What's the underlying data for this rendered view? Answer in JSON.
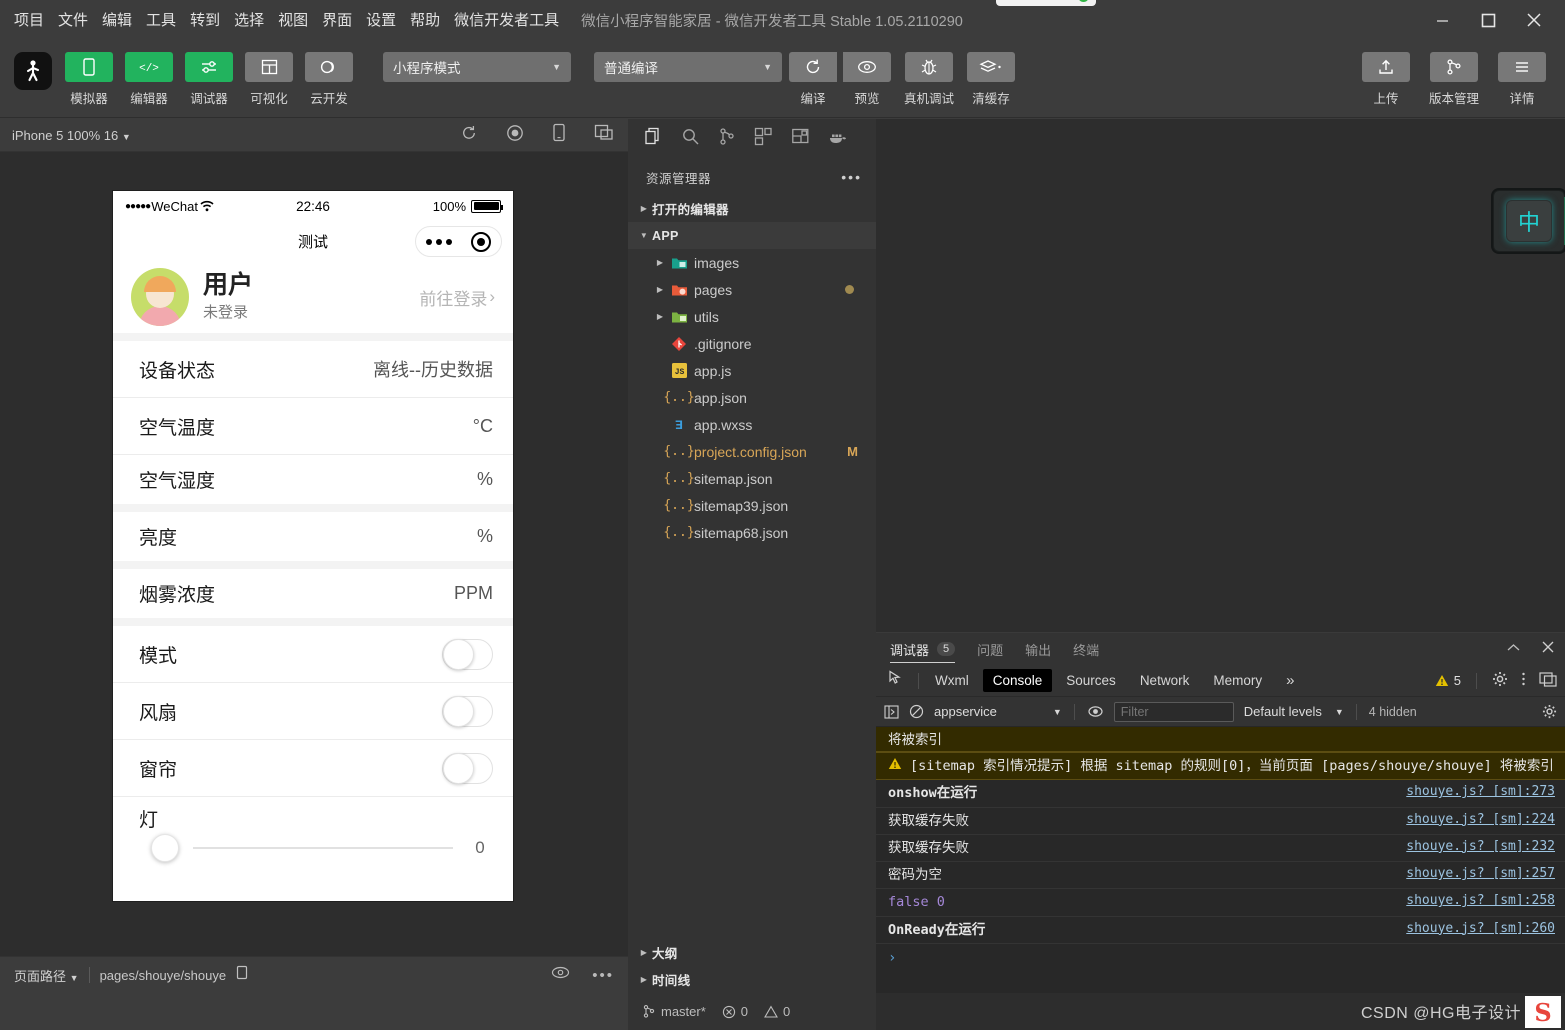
{
  "window": {
    "menu": [
      "项目",
      "文件",
      "编辑",
      "工具",
      "转到",
      "选择",
      "视图",
      "界面",
      "设置",
      "帮助",
      "微信开发者工具"
    ],
    "title": "微信小程序智能家居 - 微信开发者工具 Stable 1.05.2110290",
    "controls": {
      "minimize": "minimize-icon",
      "maximize": "maximize-icon",
      "close": "close-icon"
    }
  },
  "toolbar": {
    "avatar": "user-avatar-icon",
    "left_buttons": [
      {
        "label": "模拟器",
        "icon": "phone-icon",
        "active": true
      },
      {
        "label": "编辑器",
        "icon": "code-icon",
        "active": true
      },
      {
        "label": "调试器",
        "icon": "sliders-icon",
        "active": true
      },
      {
        "label": "可视化",
        "icon": "layout-icon",
        "active": false
      },
      {
        "label": "云开发",
        "icon": "cloud-icon",
        "active": false
      }
    ],
    "mode_select": "小程序模式",
    "compile_select": "普通编译",
    "center_buttons": [
      {
        "label": "编译",
        "icon": "refresh-icon"
      },
      {
        "label": "预览",
        "icon": "eye-icon"
      },
      {
        "label": "真机调试",
        "icon": "bug-icon"
      },
      {
        "label": "清缓存",
        "icon": "layers-icon"
      }
    ],
    "right_buttons": [
      {
        "label": "上传",
        "icon": "upload-icon"
      },
      {
        "label": "版本管理",
        "icon": "branch-icon"
      },
      {
        "label": "详情",
        "icon": "menu-icon"
      }
    ]
  },
  "simulator": {
    "device_label": "iPhone 5 100% 16",
    "bar_icons": [
      "refresh-icon",
      "record-icon",
      "rotate-device-icon",
      "multi-window-icon"
    ],
    "phone": {
      "status": {
        "carrier": "WeChat",
        "dots": "●●●●●",
        "wifi": "wifi-icon",
        "time": "22:46",
        "battery_pct": "100%"
      },
      "nav_title": "测试",
      "capsule": {
        "more": "more-dots-icon",
        "target": "target-icon"
      },
      "user": {
        "name": "用户",
        "sub": "未登录",
        "login_text": "前往登录",
        "chevron": "chevron-right-icon"
      },
      "rows": [
        {
          "label": "设备状态",
          "value": "离线--历史数据",
          "type": "value",
          "sep": false
        },
        {
          "label": "空气温度",
          "value": "°C",
          "type": "value",
          "sep": false
        },
        {
          "label": "空气湿度",
          "value": "%",
          "type": "value",
          "sep": true
        },
        {
          "label": "亮度",
          "value": "%",
          "type": "value",
          "sep": true
        },
        {
          "label": "烟雾浓度",
          "value": "PPM",
          "type": "value",
          "sep": true
        },
        {
          "label": "模式",
          "value": "",
          "type": "switch",
          "sep": false
        },
        {
          "label": "风扇",
          "value": "",
          "type": "switch",
          "sep": false
        },
        {
          "label": "窗帘",
          "value": "",
          "type": "switch",
          "sep": false
        }
      ],
      "slider": {
        "label": "灯",
        "value": "0"
      }
    },
    "footer": {
      "path_label": "页面路径",
      "path": "pages/shouye/shouye",
      "copy": "copy-icon",
      "eye": "eye-icon",
      "more": "more-icon"
    }
  },
  "explorer": {
    "activity_icons": [
      "files-icon",
      "search-icon",
      "source-control-icon",
      "extensions-icon",
      "debug-icon",
      "docker-icon"
    ],
    "title": "资源管理器",
    "more": "more-icon",
    "sections": [
      {
        "label": "打开的编辑器",
        "expanded": false
      },
      {
        "label": "APP",
        "expanded": true
      }
    ],
    "tree": [
      {
        "name": "images",
        "type": "folder",
        "icon_color": "#18a08c",
        "expanded": false,
        "indent": 2
      },
      {
        "name": "pages",
        "type": "folder",
        "icon_color": "#e85b3a",
        "expanded": false,
        "indent": 2,
        "dirty": true
      },
      {
        "name": "utils",
        "type": "folder",
        "icon_color": "#7cb342",
        "expanded": false,
        "indent": 2
      },
      {
        "name": ".gitignore",
        "type": "git",
        "icon_color": "#e8453c",
        "indent": 3
      },
      {
        "name": "app.js",
        "type": "js",
        "icon_color": "#e8c13b",
        "indent": 3
      },
      {
        "name": "app.json",
        "type": "json",
        "icon_color": "#d8a657",
        "indent": 3
      },
      {
        "name": "app.wxss",
        "type": "css",
        "icon_color": "#3b9ddd",
        "indent": 3
      },
      {
        "name": "project.config.json",
        "type": "json",
        "icon_color": "#d8a657",
        "indent": 3,
        "flag": "M",
        "modified": true
      },
      {
        "name": "sitemap.json",
        "type": "json",
        "icon_color": "#d8a657",
        "indent": 3
      },
      {
        "name": "sitemap39.json",
        "type": "json",
        "icon_color": "#d8a657",
        "indent": 3
      },
      {
        "name": "sitemap68.json",
        "type": "json",
        "icon_color": "#d8a657",
        "indent": 3
      }
    ],
    "bottom_sections": [
      {
        "label": "大纲"
      },
      {
        "label": "时间线"
      }
    ],
    "status": {
      "branch": "master*",
      "errors": "0",
      "warnings": "0"
    }
  },
  "debugger": {
    "panel_tabs": [
      {
        "label": "调试器",
        "count": "5",
        "active": true
      },
      {
        "label": "问题",
        "count": "",
        "active": false
      },
      {
        "label": "输出",
        "count": "",
        "active": false
      },
      {
        "label": "终端",
        "count": "",
        "active": false
      }
    ],
    "panel_actions": [
      "chevron-up-icon",
      "close-icon"
    ],
    "devtool_tabs": [
      {
        "label": "Wxml",
        "active": false
      },
      {
        "label": "Console",
        "active": true
      },
      {
        "label": "Sources",
        "active": false
      },
      {
        "label": "Network",
        "active": false
      },
      {
        "label": "Memory",
        "active": false
      }
    ],
    "overflow": "»",
    "warning_count": "5",
    "toolbar_icons": [
      "inspect-icon",
      "settings-icon",
      "kebab-icon",
      "dock-icon"
    ],
    "console_bar": {
      "exec_icon": "sidebar-toggle-icon",
      "clear_icon": "clear-console-icon",
      "context": "appservice",
      "eye_icon": "eye-icon",
      "filter_placeholder": "Filter",
      "filter_value": "",
      "levels": "Default levels",
      "hidden": "4 hidden",
      "settings_icon": "settings-icon"
    },
    "messages": [
      {
        "text": "将被索引",
        "source": "",
        "type": "warn-tail"
      },
      {
        "text": "[sitemap 索引情况提示] 根据 sitemap 的规则[0]，当前页面 [pages/shouye/shouye] 将被索引",
        "source": "",
        "type": "warn"
      },
      {
        "text": "onshow在运行",
        "source": "shouye.js? [sm]:273",
        "type": "log"
      },
      {
        "text": "获取缓存失败",
        "source": "shouye.js? [sm]:224",
        "type": "log"
      },
      {
        "text": "获取缓存失败",
        "source": "shouye.js? [sm]:232",
        "type": "log"
      },
      {
        "text": "密码为空",
        "source": "shouye.js? [sm]:257",
        "type": "log"
      },
      {
        "text": "false 0",
        "source": "shouye.js? [sm]:258",
        "type": "value"
      },
      {
        "text": "OnReady在运行",
        "source": "shouye.js? [sm]:260",
        "type": "log"
      }
    ],
    "prompt": "›"
  },
  "ime": {
    "label": "中"
  },
  "watermark": {
    "text": "CSDN @HG电子设计",
    "logo": "S"
  },
  "colors": {
    "accent_green": "#22b35e",
    "titlebar": "#3c3c3c",
    "panel": "#333333",
    "editor_bg": "#2d2d2d",
    "console_bg": "#282828",
    "warn_bg": "#332b00",
    "link": "#9cc3e0"
  }
}
